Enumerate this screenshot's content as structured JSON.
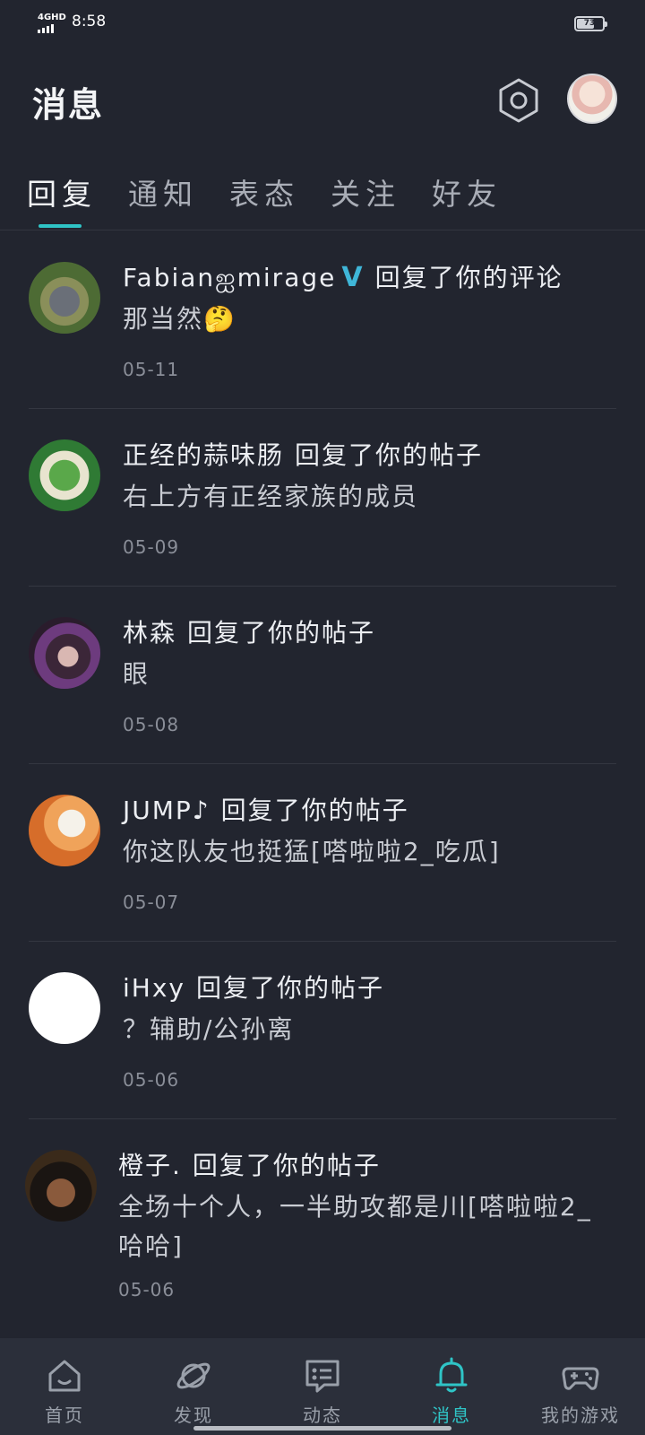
{
  "status_bar": {
    "network": "4GHD",
    "time": "8:58",
    "battery": "73",
    "battery_level": 0.73
  },
  "header": {
    "title": "消息"
  },
  "tabs": [
    {
      "label": "回复",
      "active": true
    },
    {
      "label": "通知",
      "active": false
    },
    {
      "label": "表态",
      "active": false
    },
    {
      "label": "关注",
      "active": false
    },
    {
      "label": "好友",
      "active": false
    }
  ],
  "messages": [
    {
      "user": "Fabianஐmirage",
      "verified_badge": "V",
      "action": "回复了你的评论",
      "content": "那当然🤔",
      "date": "05-11"
    },
    {
      "user": "正经的蒜味肠",
      "action": "回复了你的帖子",
      "content": "右上方有正经家族的成员",
      "date": "05-09"
    },
    {
      "user": "林森",
      "action": "回复了你的帖子",
      "content": "眼",
      "date": "05-08"
    },
    {
      "user": "JUMP♪",
      "action": "回复了你的帖子",
      "content": "你这队友也挺猛[嗒啦啦2_吃瓜]",
      "date": "05-07"
    },
    {
      "user": "iHxy",
      "action": "回复了你的帖子",
      "content": "？辅助/公孙离",
      "date": "05-06"
    },
    {
      "user": "橙子.",
      "action": "回复了你的帖子",
      "content": "全场十个人，一半助攻都是川[嗒啦啦2_哈哈]",
      "date": "05-06"
    }
  ],
  "bottom_nav": [
    {
      "label": "首页",
      "icon": "home-icon",
      "active": false
    },
    {
      "label": "发现",
      "icon": "planet-icon",
      "active": false
    },
    {
      "label": "动态",
      "icon": "chat-card-icon",
      "active": false
    },
    {
      "label": "消息",
      "icon": "bell-icon",
      "active": true
    },
    {
      "label": "我的游戏",
      "icon": "gamepad-icon",
      "active": false
    }
  ],
  "colors": {
    "background": "#22252f",
    "accent": "#2fc4c6",
    "nav_background": "#2b2f3a",
    "verified": "#3fb6d8"
  }
}
